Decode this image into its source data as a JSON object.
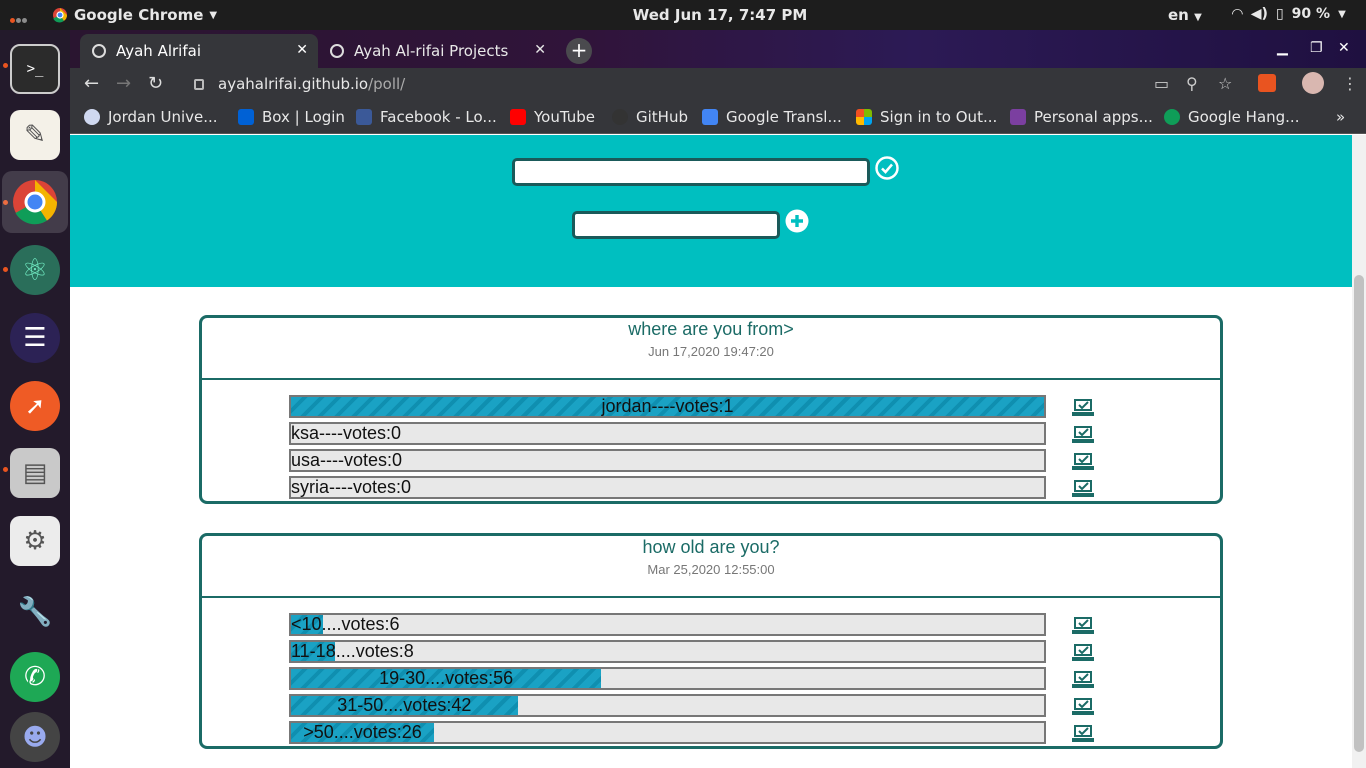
{
  "topbar": {
    "activities": "",
    "app_name": "Google Chrome",
    "clock": "Wed Jun 17,  7:47 PM",
    "lang": "en",
    "battery": "90 %"
  },
  "tabs": [
    {
      "title": "Ayah Alrifai",
      "active": true
    },
    {
      "title": "Ayah Al-rifai Projects",
      "active": false
    }
  ],
  "toolbar": {
    "url_host": "ayahalrifai.github.io",
    "url_path": "/poll/"
  },
  "bookmarks": [
    {
      "label": "Jordan Unive...",
      "icon_color": "#cfd8f0"
    },
    {
      "label": "Box | Login",
      "icon_color": "#0061d5"
    },
    {
      "label": "Facebook - Lo...",
      "icon_color": "#3b5998"
    },
    {
      "label": "YouTube",
      "icon_color": "#ff0000"
    },
    {
      "label": "GitHub",
      "icon_color": "#333333"
    },
    {
      "label": "Google Transl...",
      "icon_color": "#4285f4"
    },
    {
      "label": "Sign in to Out...",
      "icon_color": "#f25022"
    },
    {
      "label": "Personal apps...",
      "icon_color": "#7b3fa0"
    },
    {
      "label": "Google Hang...",
      "icon_color": "#0f9d58"
    }
  ],
  "form": {
    "question_placeholder": "",
    "option_placeholder": ""
  },
  "colors": {
    "accent": "#00bfc0",
    "card_border": "#1b6b66",
    "bar_fill": "#1aa2c4"
  },
  "polls": [
    {
      "question": "where are you from>",
      "date": "Jun 17,2020 19:47:20",
      "options": [
        {
          "label": "jordan----votes:1",
          "percent": 100
        },
        {
          "label": "ksa----votes:0",
          "percent": 0
        },
        {
          "label": "usa----votes:0",
          "percent": 0
        },
        {
          "label": "syria----votes:0",
          "percent": 0
        }
      ]
    },
    {
      "question": "how old are you?",
      "date": "Mar 25,2020 12:55:00",
      "options": [
        {
          "label": "<10....votes:6",
          "percent": 4.2
        },
        {
          "label": "11-18....votes:8",
          "percent": 5.9
        },
        {
          "label": "19-30....votes:56",
          "percent": 41.2
        },
        {
          "label": "31-50....votes:42",
          "percent": 30.1
        },
        {
          "label": ">50....votes:26",
          "percent": 19.0
        }
      ]
    }
  ]
}
